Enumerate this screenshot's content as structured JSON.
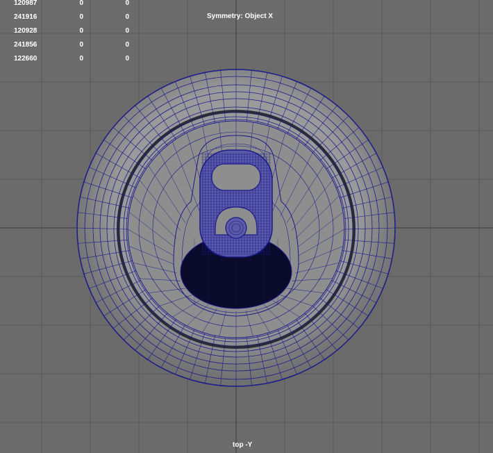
{
  "poly_count_rows": [
    [
      "120987",
      "0",
      "0"
    ],
    [
      "241916",
      "0",
      "0"
    ],
    [
      "120928",
      "0",
      "0"
    ],
    [
      "241856",
      "0",
      "0"
    ],
    [
      "122660",
      "0",
      "0"
    ]
  ],
  "symmetry_label": "Symmetry: Object X",
  "camera_label": "top -Y",
  "colors": {
    "background": "#6b6b6b",
    "grid": "#5a5a5a",
    "axis": "#3a3a3a",
    "wireframe": "#1a1a8a",
    "mesh_fill": "#8e8e8e",
    "opening": "#0a0a2a",
    "hud_text": "#ffffff"
  }
}
